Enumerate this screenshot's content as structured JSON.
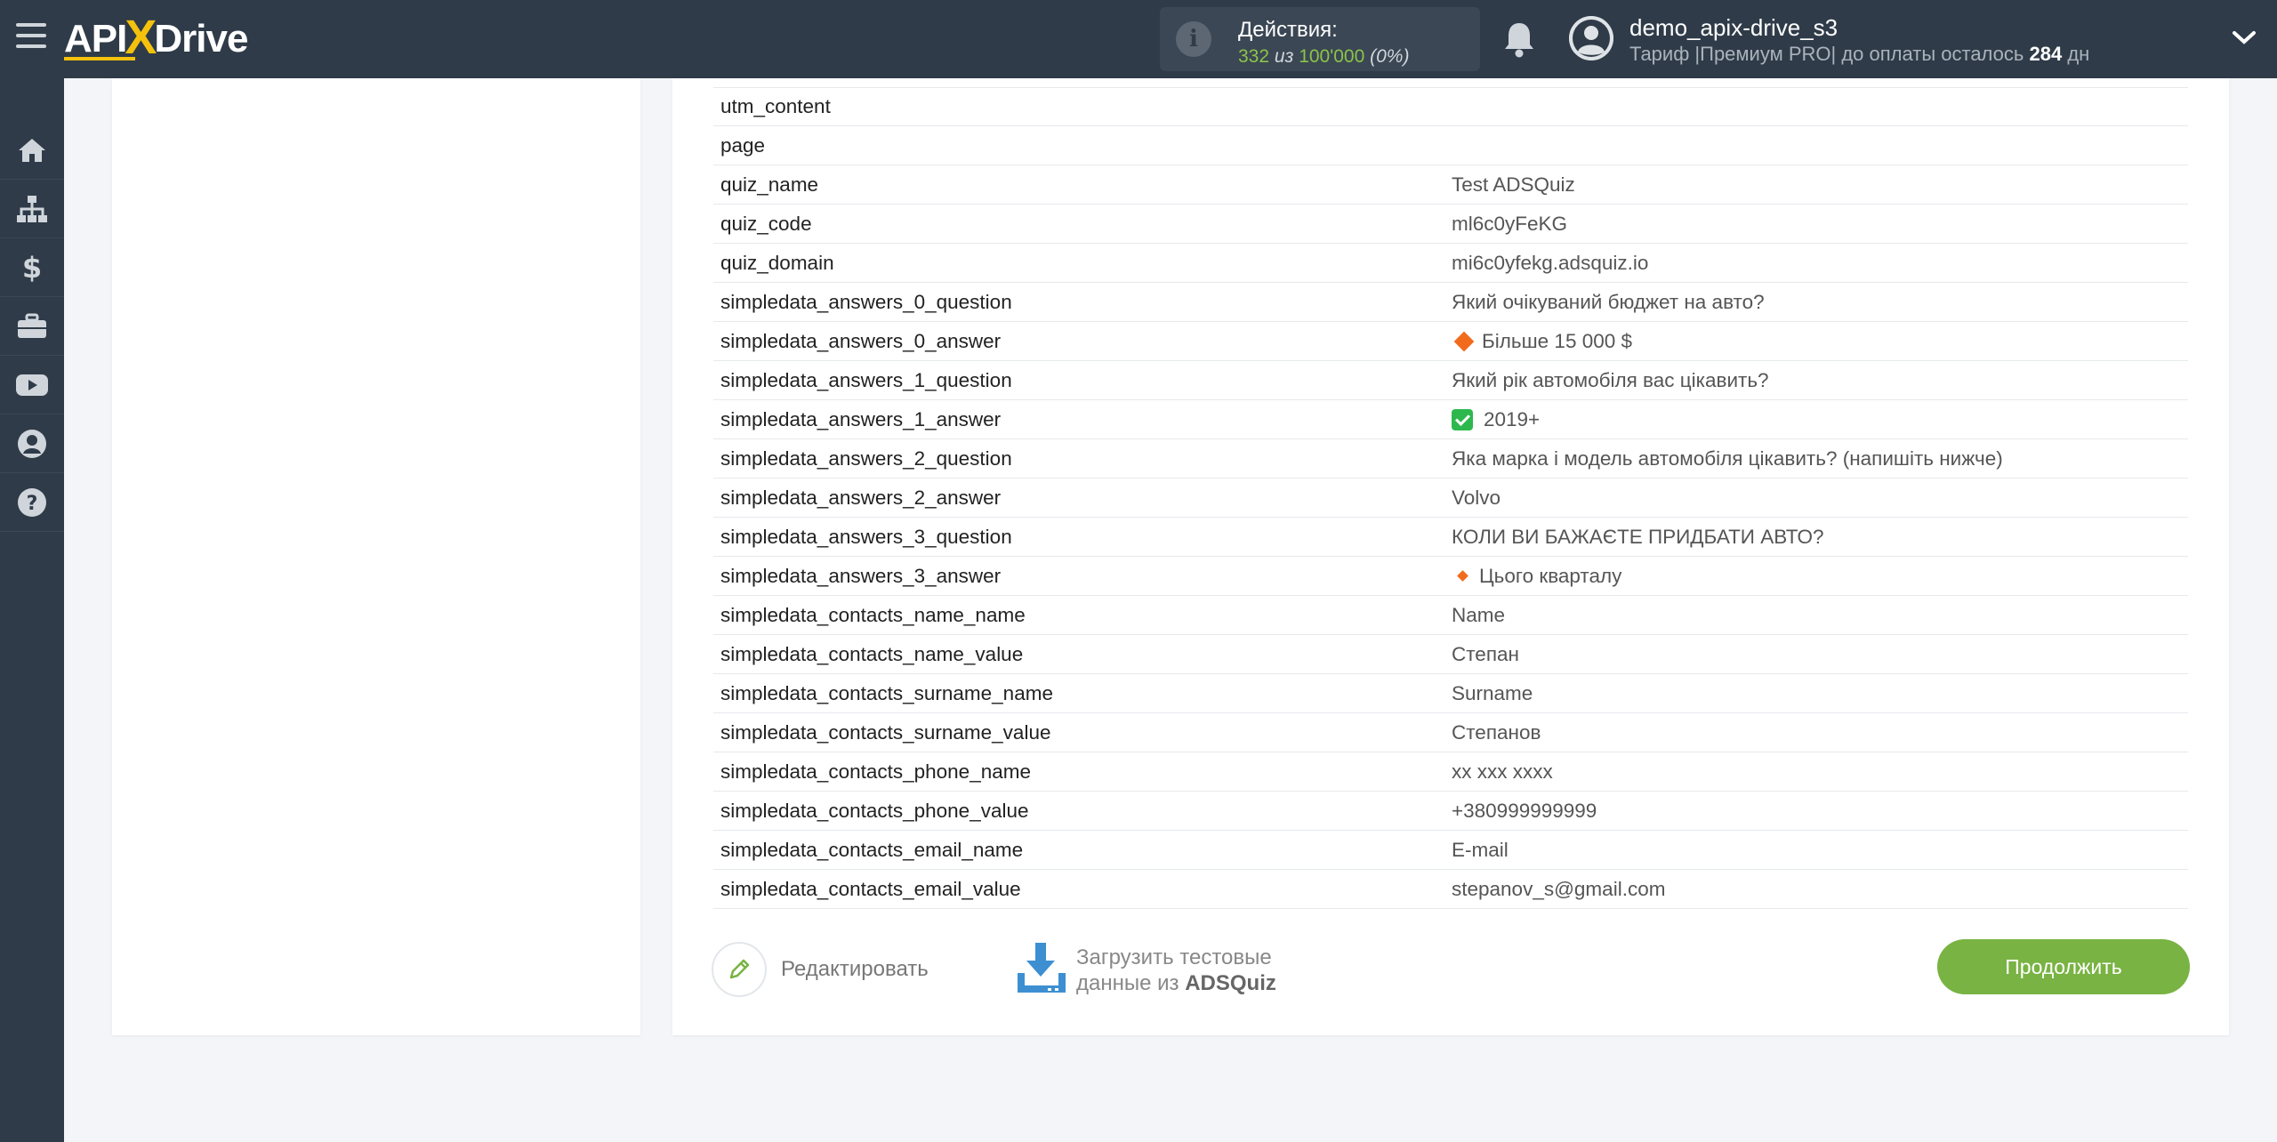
{
  "header": {
    "logo": {
      "part1": "API",
      "part2": "X",
      "part3": "Drive"
    },
    "actions": {
      "label": "Действия:",
      "used": "332",
      "of": "из",
      "total": "100'000",
      "percent": "(0%)"
    },
    "user": {
      "name": "demo_apix-drive_s3",
      "plan_prefix": "Тариф |Премиум PRO| до оплаты осталось",
      "days": "284",
      "days_unit": "дн"
    }
  },
  "sidebar": {
    "items": [
      "home-icon",
      "sitemap-icon",
      "dollar-icon",
      "briefcase-icon",
      "youtube-icon",
      "user-icon",
      "help-icon"
    ]
  },
  "table": {
    "rows": [
      {
        "key": "utm_content",
        "value": ""
      },
      {
        "key": "page",
        "value": ""
      },
      {
        "key": "quiz_name",
        "value": "Test ADSQuiz"
      },
      {
        "key": "quiz_code",
        "value": "ml6c0yFeKG"
      },
      {
        "key": "quiz_domain",
        "value": "mi6c0yfekg.adsquiz.io"
      },
      {
        "key": "simpledata_answers_0_question",
        "value": "Який очікуваний бюджет на авто?"
      },
      {
        "key": "simpledata_answers_0_answer",
        "value": "Більше 15 000 $",
        "marker": "diamond-large"
      },
      {
        "key": "simpledata_answers_1_question",
        "value": "Який рік автомобіля вас цікавить?"
      },
      {
        "key": "simpledata_answers_1_answer",
        "value": "2019+",
        "marker": "check"
      },
      {
        "key": "simpledata_answers_2_question",
        "value": "Яка марка і модель автомобіля цікавить? (напишіть нижче)"
      },
      {
        "key": "simpledata_answers_2_answer",
        "value": "Volvo"
      },
      {
        "key": "simpledata_answers_3_question",
        "value": "КОЛИ ВИ БАЖАЄТЕ ПРИДБАТИ АВТО?"
      },
      {
        "key": "simpledata_answers_3_answer",
        "value": "Цього кварталу",
        "marker": "diamond-small"
      },
      {
        "key": "simpledata_contacts_name_name",
        "value": "Name"
      },
      {
        "key": "simpledata_contacts_name_value",
        "value": "Степан"
      },
      {
        "key": "simpledata_contacts_surname_name",
        "value": "Surname"
      },
      {
        "key": "simpledata_contacts_surname_value",
        "value": "Степанов"
      },
      {
        "key": "simpledata_contacts_phone_name",
        "value": "xx xxx xxxx"
      },
      {
        "key": "simpledata_contacts_phone_value",
        "value": "+380999999999"
      },
      {
        "key": "simpledata_contacts_email_name",
        "value": "E-mail"
      },
      {
        "key": "simpledata_contacts_email_value",
        "value": "stepanov_s@gmail.com"
      }
    ]
  },
  "footer": {
    "edit_label": "Редактировать",
    "load_line1": "Загрузить тестовые",
    "load_line2_prefix": "данные из",
    "load_source": "ADSQuiz",
    "continue_label": "Продолжить"
  },
  "colors": {
    "header_bg": "#2f3b48",
    "accent_green": "#79b343",
    "logo_yellow": "#f4c20d",
    "marker_orange": "#f26b1d",
    "check_green": "#2db84d"
  }
}
